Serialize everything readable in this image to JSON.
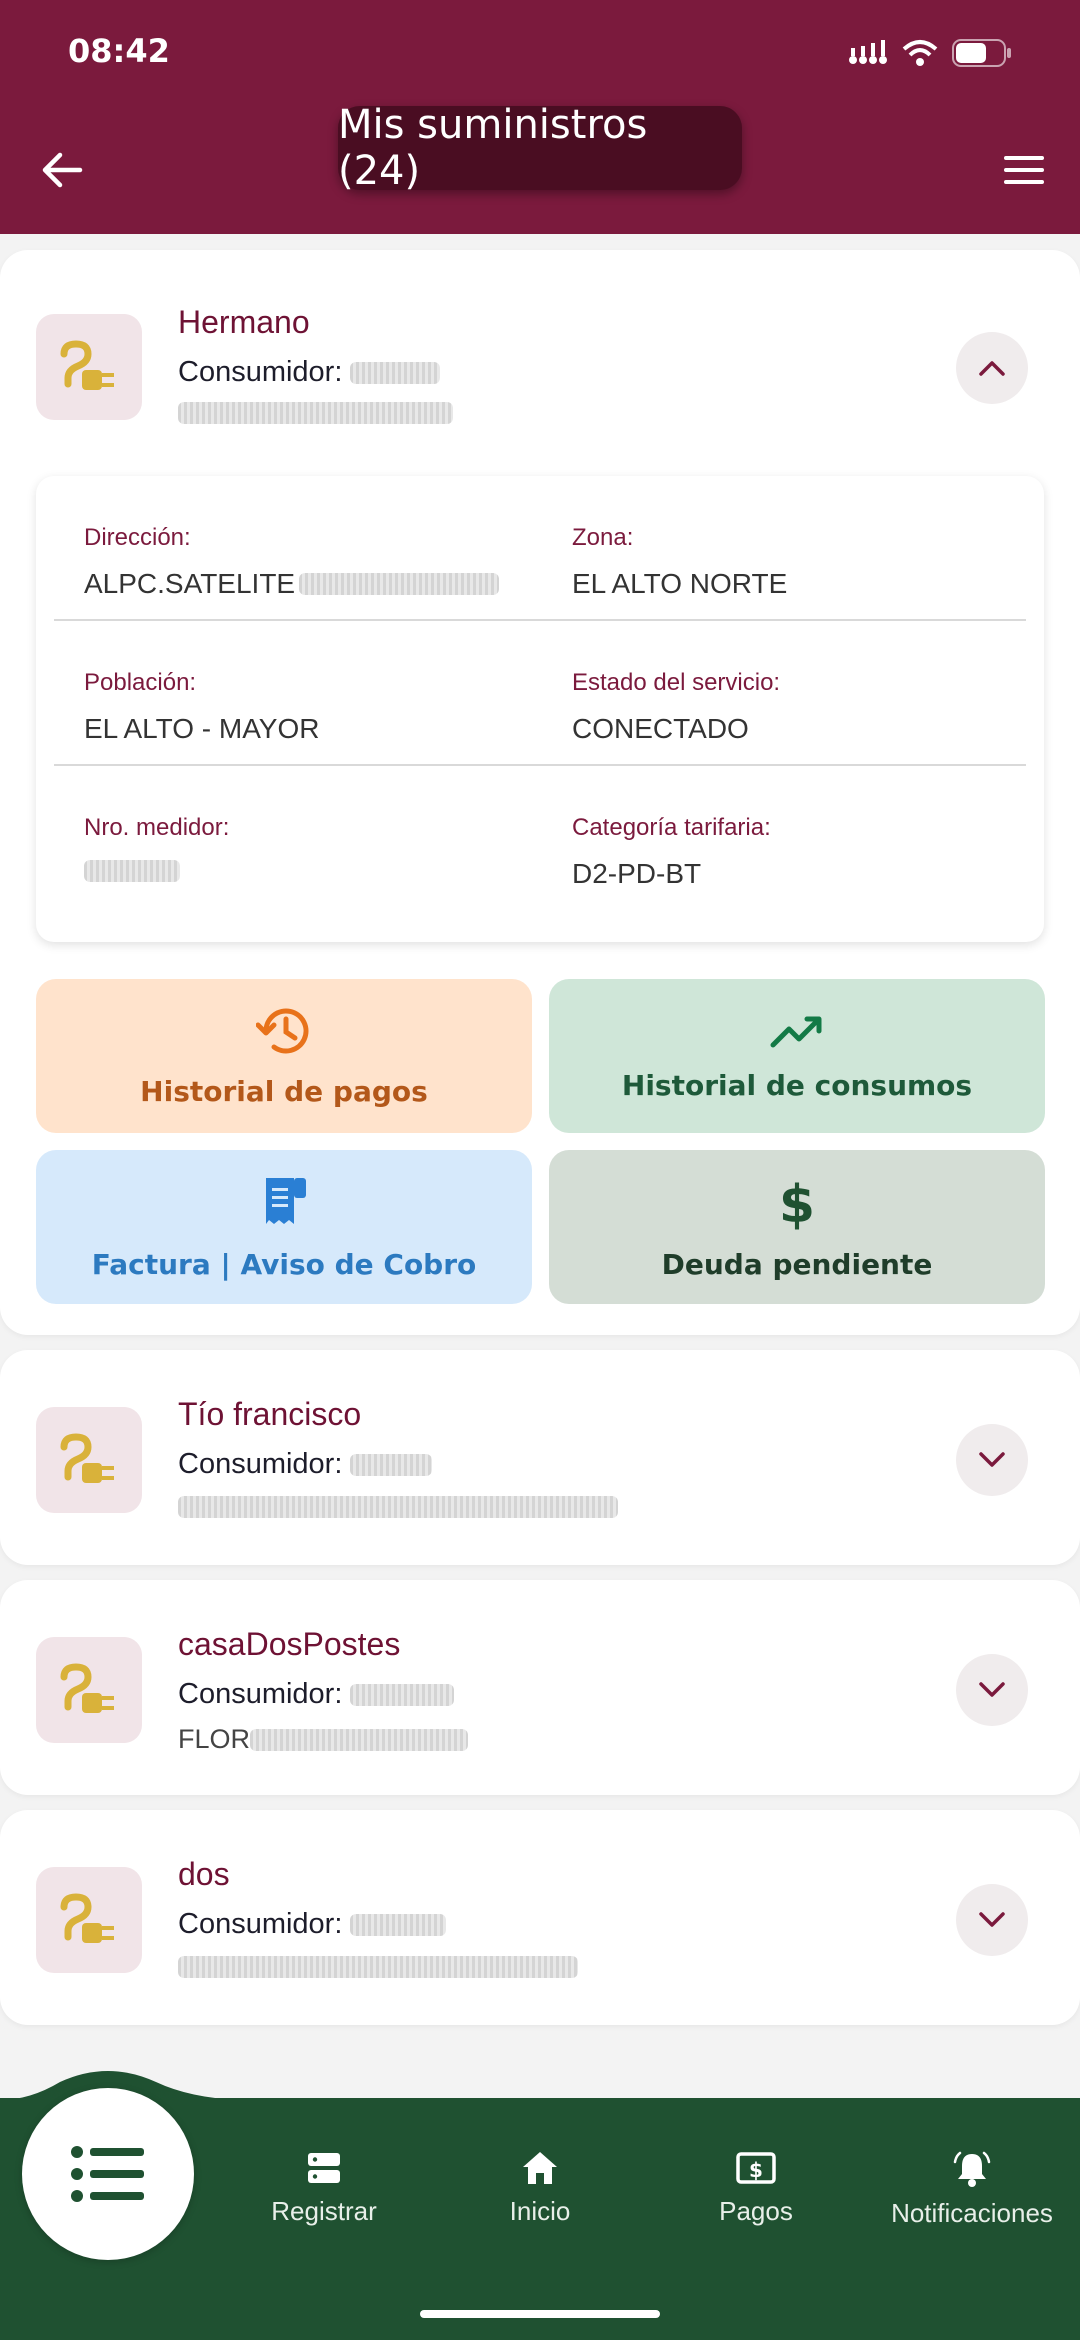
{
  "status_bar": {
    "time": "08:42"
  },
  "header": {
    "title": "Mis suministros (24)"
  },
  "supplies": [
    {
      "name": "Hermano",
      "consumer_label": "Consumidor:",
      "expanded": true,
      "details": {
        "direccion_label": "Dirección:",
        "direccion_value": "ALPC.SATELITE",
        "zona_label": "Zona:",
        "zona_value": "EL ALTO NORTE",
        "poblacion_label": "Población:",
        "poblacion_value": "EL ALTO - MAYOR",
        "estado_label": "Estado del servicio:",
        "estado_value": "CONECTADO",
        "medidor_label": "Nro. medidor:",
        "categoria_label": "Categoría tarifaria:",
        "categoria_value": "D2-PD-BT"
      },
      "actions": {
        "historial_pagos": "Historial de pagos",
        "historial_consumos": "Historial de consumos",
        "factura": "Factura | Aviso de Cobro",
        "deuda": "Deuda pendiente"
      }
    },
    {
      "name": "Tío francisco",
      "consumer_label": "Consumidor:",
      "expanded": false
    },
    {
      "name": "casaDosPostes",
      "consumer_label": "Consumidor:",
      "address_prefix": "FLOR",
      "expanded": false
    },
    {
      "name": "dos",
      "consumer_label": "Consumidor:",
      "expanded": false
    }
  ],
  "bottom_nav": {
    "items": [
      {
        "label": "Registrar",
        "icon": "server-icon"
      },
      {
        "label": "Inicio",
        "icon": "home-icon"
      },
      {
        "label": "Pagos",
        "icon": "dollar-bill-icon"
      },
      {
        "label": "Notificaciones",
        "icon": "bell-icon"
      }
    ],
    "fab_icon": "list-icon"
  },
  "colors": {
    "primary": "#7b1a3d",
    "nav_green": "#1f5131",
    "plug_yellow": "#d9b23a",
    "pagos_bg": "#ffe3cc",
    "consumos_bg": "#cfe6d8",
    "factura_bg": "#d6e9fb",
    "deuda_bg": "#d4ddd5"
  }
}
